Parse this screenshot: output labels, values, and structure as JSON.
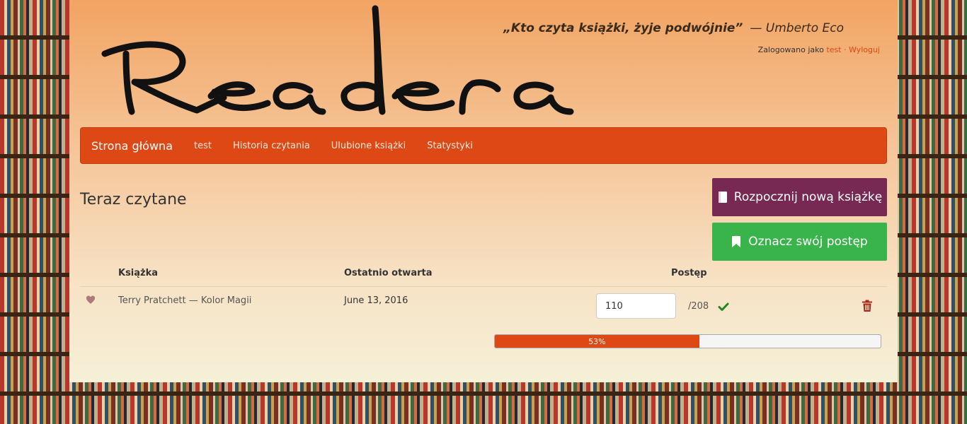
{
  "header": {
    "logo_text": "Readera",
    "quote": "„Kto czyta książki, żyje podwójnie”",
    "quote_author": "— Umberto Eco",
    "login_prefix": "Zalogowano jako",
    "username": "test",
    "separator": "·",
    "logout_label": "Wyloguj"
  },
  "nav": {
    "brand": "Strona główna",
    "items": [
      {
        "label": "test"
      },
      {
        "label": "Historia czytania"
      },
      {
        "label": "Ulubione książki"
      },
      {
        "label": "Statystyki"
      }
    ]
  },
  "main": {
    "title": "Teraz czytane",
    "start_button": "Rozpocznij nową książkę",
    "progress_button": "Oznacz swój postęp",
    "table": {
      "headers": [
        "Książka",
        "Ostatnio otwarta",
        "Postęp"
      ],
      "rows": [
        {
          "book": "Terry Pratchett — Kolor Magii",
          "last_opened": "June 13, 2016",
          "current_page": "110",
          "total_pages": "/208",
          "progress_percent": 53,
          "progress_label": "53%"
        }
      ]
    }
  },
  "colors": {
    "accent": "#dd4814",
    "start_button": "#772953",
    "progress_button": "#38b44a",
    "favorite_heart": "#b07a7a",
    "check": "#1f8a1f",
    "trash": "#a52a1c"
  },
  "icons": {
    "start_button_icon": "book-icon",
    "progress_button_icon": "bookmark-icon",
    "favorite_icon": "heart-icon",
    "confirm_icon": "check-icon",
    "delete_icon": "trash-icon"
  }
}
